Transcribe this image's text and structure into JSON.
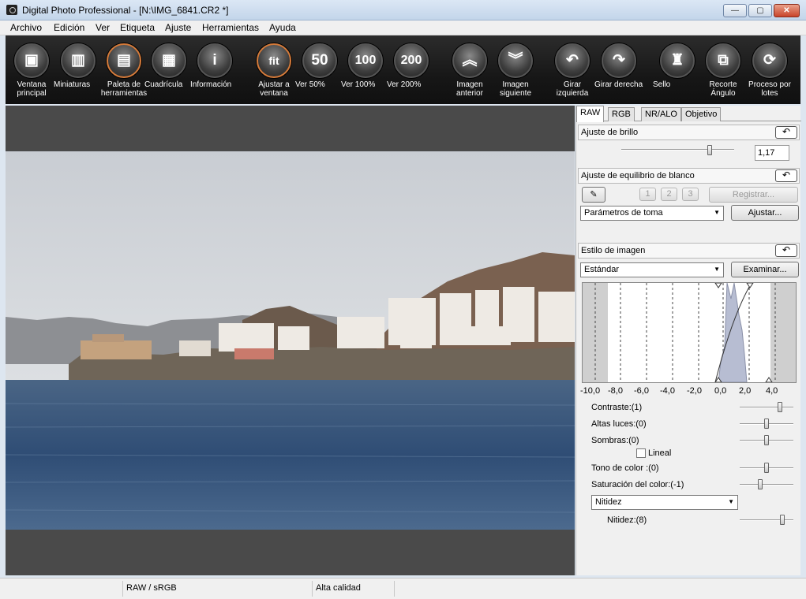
{
  "window": {
    "title": "Digital Photo Professional - [N:\\IMG_6841.CR2 *]",
    "min_label": "—",
    "max_label": "▢",
    "close_label": "✕"
  },
  "menu": [
    "Archivo",
    "Edición",
    "Ver",
    "Etiqueta",
    "Ajuste",
    "Herramientas",
    "Ayuda"
  ],
  "toolbar": [
    {
      "icon": "main-window-icon",
      "glyph": "▣",
      "label": "Ventana principal"
    },
    {
      "icon": "thumbnails-icon",
      "glyph": "▥",
      "label": "Miniaturas"
    },
    {
      "icon": "tool-palette-icon",
      "glyph": "▤",
      "label": "Paleta de herramientas"
    },
    {
      "icon": "grid-icon",
      "glyph": "▦",
      "label": "Cuadrícula"
    },
    {
      "icon": "info-icon",
      "glyph": "i",
      "label": "Información"
    },
    {
      "icon": "fit-icon",
      "glyph": "fit",
      "label": "Ajustar a ventana"
    },
    {
      "icon": "zoom-50-icon",
      "glyph": "50",
      "label": "Ver 50%"
    },
    {
      "icon": "zoom-100-icon",
      "glyph": "100",
      "label": "Ver 100%"
    },
    {
      "icon": "zoom-200-icon",
      "glyph": "200",
      "label": "Ver 200%"
    },
    {
      "icon": "previous-image-icon",
      "glyph": "︽",
      "label": "Imagen anterior"
    },
    {
      "icon": "next-image-icon",
      "glyph": "︾",
      "label": "Imagen siguiente"
    },
    {
      "icon": "rotate-left-icon",
      "glyph": "↶",
      "label": "Girar izquierda"
    },
    {
      "icon": "rotate-right-icon",
      "glyph": "↷",
      "label": "Girar derecha"
    },
    {
      "icon": "stamp-icon",
      "glyph": "♜",
      "label": "Sello"
    },
    {
      "icon": "crop-angle-icon",
      "glyph": "⧉",
      "label": "Recorte Ángulo"
    },
    {
      "icon": "batch-process-icon",
      "glyph": "⟳",
      "label": "Proceso por lotes"
    }
  ],
  "panel": {
    "tabs": [
      "RAW",
      "RGB",
      "NR/ALO",
      "Objetivo"
    ],
    "active_tab": "RAW",
    "brightness": {
      "header": "Ajuste de brillo",
      "value": "1,17",
      "level": 0.78
    },
    "white_balance": {
      "header": "Ajuste de equilibrio de blanco",
      "presets": [
        "1",
        "2",
        "3"
      ],
      "register_label": "Registrar...",
      "mode": "Parámetros de toma",
      "adjust_label": "Ajustar..."
    },
    "picture_style": {
      "header": "Estilo de imagen",
      "style": "Estándar",
      "browse_label": "Examinar...",
      "axis_ticks": [
        "-10,0",
        "-8,0",
        "-6,0",
        "-4,0",
        "-2,0",
        "0,0",
        "2,0",
        "4,0"
      ],
      "controls": [
        {
          "label": "Contraste:(1)",
          "level": 0.75
        },
        {
          "label": "Altas luces:(0)",
          "level": 0.5
        },
        {
          "label": "Sombras:(0)",
          "level": 0.5
        },
        {
          "label": "Tono de color :(0)",
          "level": 0.5
        },
        {
          "label": "Saturación del color:(-1)",
          "level": 0.38
        }
      ],
      "linear_label": "Lineal",
      "sharpness_mode": "Nitidez",
      "sharpness_label": "Nitidez:(8)",
      "sharpness_level": 0.8
    }
  },
  "status": {
    "cells": [
      "",
      "RAW / sRGB",
      "Alta calidad",
      ""
    ]
  },
  "colors": {
    "toolbar_bg": "#1a1a1a",
    "preview_bg": "#4a4a4a",
    "sky": "#d3d7dc",
    "sea": "#3d5a7e",
    "histogram_fill": "#b7bdd2"
  }
}
